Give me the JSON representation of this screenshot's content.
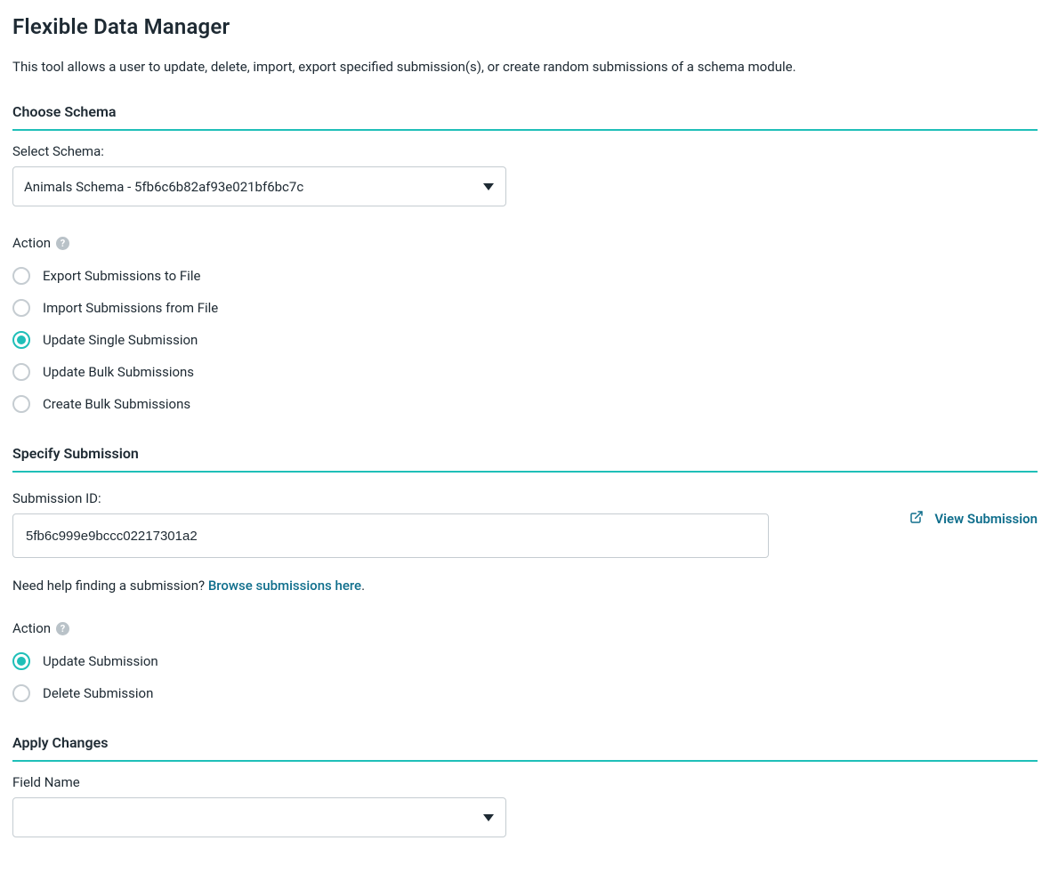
{
  "page": {
    "title": "Flexible Data Manager",
    "intro": "This tool allows a user to update, delete, import, export specified submission(s), or create random submissions of a schema module."
  },
  "choose_schema": {
    "heading": "Choose Schema",
    "select_label": "Select Schema:",
    "selected_value": "Animals Schema - 5fb6c6b82af93e021bf6bc7c",
    "action_label": "Action",
    "options": [
      {
        "label": "Export Submissions to File",
        "selected": false
      },
      {
        "label": "Import Submissions from File",
        "selected": false
      },
      {
        "label": "Update Single Submission",
        "selected": true
      },
      {
        "label": "Update Bulk Submissions",
        "selected": false
      },
      {
        "label": "Create Bulk Submissions",
        "selected": false
      }
    ]
  },
  "specify_submission": {
    "heading": "Specify Submission",
    "id_label": "Submission ID:",
    "id_value": "5fb6c999e9bccc02217301a2",
    "view_link_label": "View Submission",
    "hint_prefix": "Need help finding a submission? ",
    "hint_link": "Browse submissions here",
    "hint_suffix": ".",
    "action_label": "Action",
    "options": [
      {
        "label": "Update Submission",
        "selected": true
      },
      {
        "label": "Delete Submission",
        "selected": false
      }
    ]
  },
  "apply_changes": {
    "heading": "Apply Changes",
    "field_name_label": "Field Name",
    "field_name_value": ""
  }
}
